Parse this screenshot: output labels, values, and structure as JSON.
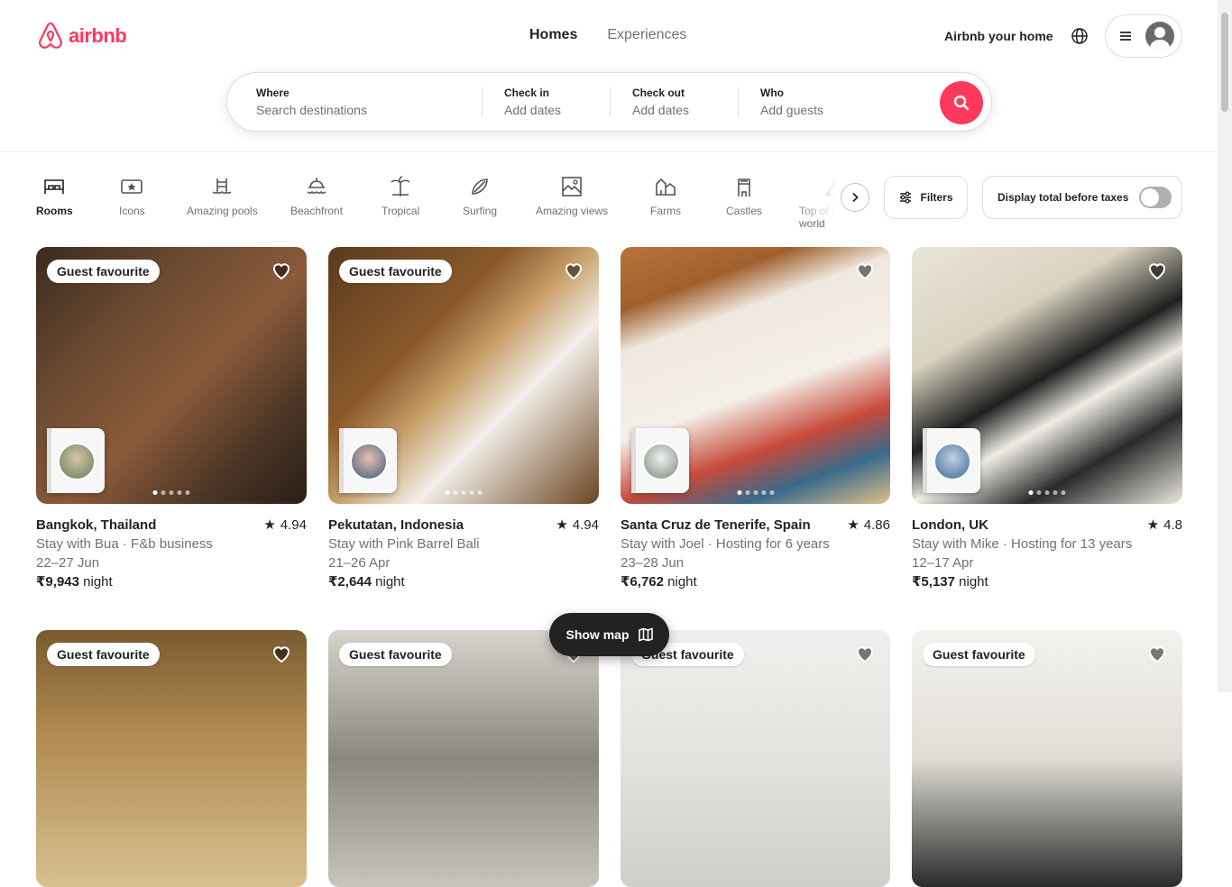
{
  "brand": {
    "name": "airbnb",
    "color": "#ff385c"
  },
  "nav": {
    "homes": "Homes",
    "experiences": "Experiences"
  },
  "header": {
    "host_link": "Airbnb your home"
  },
  "search": {
    "where_label": "Where",
    "where_placeholder": "Search destinations",
    "checkin_label": "Check in",
    "checkin_value": "Add dates",
    "checkout_label": "Check out",
    "checkout_value": "Add dates",
    "who_label": "Who",
    "who_value": "Add guests"
  },
  "categories": [
    "Rooms",
    "Icons",
    "Amazing pools",
    "Beachfront",
    "Tropical",
    "Surfing",
    "Amazing views",
    "Farms",
    "Castles",
    "Top of the world"
  ],
  "filters": {
    "label": "Filters"
  },
  "tax_toggle": {
    "label": "Display total before taxes"
  },
  "listings": [
    {
      "badge": "Guest favourite",
      "title": "Bangkok, Thailand",
      "rating": "4.94",
      "host": "Stay with Bua · F&b business",
      "dates": "22–27 Jun",
      "price": "₹9,943",
      "unit": "night"
    },
    {
      "badge": "Guest favourite",
      "title": "Pekutatan, Indonesia",
      "rating": "4.94",
      "host": "Stay with Pink Barrel Bali",
      "dates": "21–26 Apr",
      "price": "₹2,644",
      "unit": "night"
    },
    {
      "badge": "",
      "title": "Santa Cruz de Tenerife, Spain",
      "rating": "4.86",
      "host": "Stay with Joel · Hosting for 6 years",
      "dates": "23–28 Jun",
      "price": "₹6,762",
      "unit": "night"
    },
    {
      "badge": "",
      "title": "London, UK",
      "rating": "4.8",
      "host": "Stay with Mike · Hosting for 13 years",
      "dates": "12–17 Apr",
      "price": "₹5,137",
      "unit": "night"
    }
  ],
  "row2_badges": [
    "Guest favourite",
    "Guest favourite",
    "Guest favourite",
    "Guest favourite"
  ],
  "show_map": {
    "label": "Show map"
  }
}
